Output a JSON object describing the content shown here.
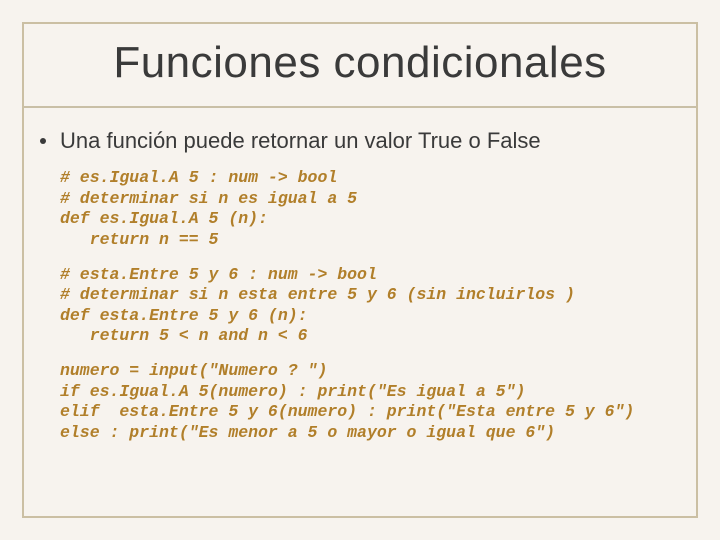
{
  "title": "Funciones condicionales",
  "bullet": "Una función puede retornar un valor True o False",
  "code1": "# es.Igual.A 5 : num -> bool\n# determinar si n es igual a 5\ndef es.Igual.A 5 (n):\n   return n == 5",
  "code2": "# esta.Entre 5 y 6 : num -> bool\n# determinar si n esta entre 5 y 6 (sin incluirlos )\ndef esta.Entre 5 y 6 (n):\n   return 5 < n and n < 6",
  "code3": "numero = input(\"Numero ? \")\nif es.Igual.A 5(numero) : print(\"Es igual a 5\")\nelif  esta.Entre 5 y 6(numero) : print(\"Esta entre 5 y 6\")\nelse : print(\"Es menor a 5 o mayor o igual que 6\")"
}
